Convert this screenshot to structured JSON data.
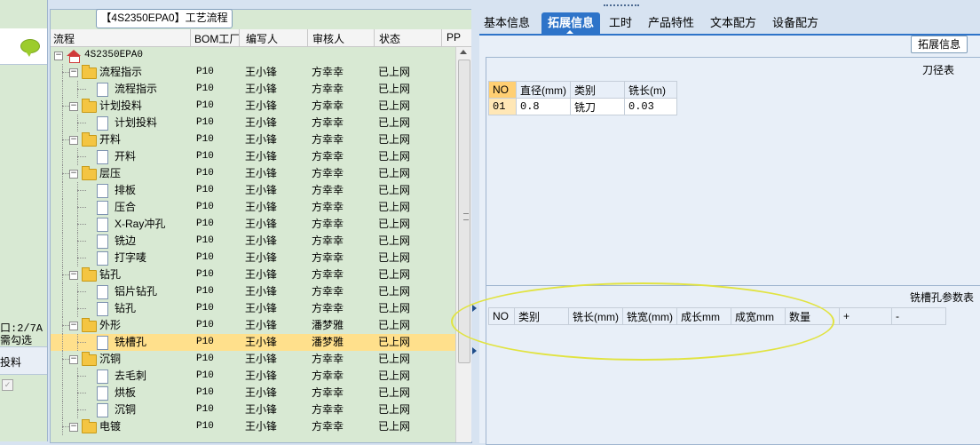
{
  "left_strip": {
    "line1": "口:2/7A",
    "line2": "需勾选",
    "header_label": "投料"
  },
  "tree": {
    "title": "【4S2350EPA0】工艺流程",
    "columns": [
      "流程",
      "BOM工厂",
      "编写人",
      "审核人",
      "状态",
      "PP"
    ],
    "rows": [
      {
        "label": "4S2350EPA0",
        "level": 0,
        "kind": "root",
        "factory": "",
        "writer": "",
        "reviewer": "",
        "status": ""
      },
      {
        "label": "流程指示",
        "level": 1,
        "kind": "folder",
        "factory": "P10",
        "writer": "王小锋",
        "reviewer": "方幸幸",
        "status": "已上网"
      },
      {
        "label": "流程指示",
        "level": 2,
        "kind": "doc",
        "factory": "P10",
        "writer": "王小锋",
        "reviewer": "方幸幸",
        "status": "已上网"
      },
      {
        "label": "计划投料",
        "level": 1,
        "kind": "folder",
        "factory": "P10",
        "writer": "王小锋",
        "reviewer": "方幸幸",
        "status": "已上网"
      },
      {
        "label": "计划投料",
        "level": 2,
        "kind": "doc",
        "factory": "P10",
        "writer": "王小锋",
        "reviewer": "方幸幸",
        "status": "已上网"
      },
      {
        "label": "开料",
        "level": 1,
        "kind": "folder",
        "factory": "P10",
        "writer": "王小锋",
        "reviewer": "方幸幸",
        "status": "已上网"
      },
      {
        "label": "开料",
        "level": 2,
        "kind": "doc",
        "factory": "P10",
        "writer": "王小锋",
        "reviewer": "方幸幸",
        "status": "已上网"
      },
      {
        "label": "层压",
        "level": 1,
        "kind": "folder",
        "factory": "P10",
        "writer": "王小锋",
        "reviewer": "方幸幸",
        "status": "已上网"
      },
      {
        "label": "排板",
        "level": 2,
        "kind": "doc",
        "factory": "P10",
        "writer": "王小锋",
        "reviewer": "方幸幸",
        "status": "已上网"
      },
      {
        "label": "压合",
        "level": 2,
        "kind": "doc",
        "factory": "P10",
        "writer": "王小锋",
        "reviewer": "方幸幸",
        "status": "已上网"
      },
      {
        "label": "X-Ray冲孔",
        "level": 2,
        "kind": "doc",
        "factory": "P10",
        "writer": "王小锋",
        "reviewer": "方幸幸",
        "status": "已上网"
      },
      {
        "label": "铣边",
        "level": 2,
        "kind": "doc",
        "factory": "P10",
        "writer": "王小锋",
        "reviewer": "方幸幸",
        "status": "已上网"
      },
      {
        "label": "打字唛",
        "level": 2,
        "kind": "doc",
        "factory": "P10",
        "writer": "王小锋",
        "reviewer": "方幸幸",
        "status": "已上网"
      },
      {
        "label": "钻孔",
        "level": 1,
        "kind": "folder",
        "factory": "P10",
        "writer": "王小锋",
        "reviewer": "方幸幸",
        "status": "已上网"
      },
      {
        "label": "铝片钻孔",
        "level": 2,
        "kind": "doc",
        "factory": "P10",
        "writer": "王小锋",
        "reviewer": "方幸幸",
        "status": "已上网"
      },
      {
        "label": "钻孔",
        "level": 2,
        "kind": "doc",
        "factory": "P10",
        "writer": "王小锋",
        "reviewer": "方幸幸",
        "status": "已上网"
      },
      {
        "label": "外形",
        "level": 1,
        "kind": "folder",
        "factory": "P10",
        "writer": "王小锋",
        "reviewer": "潘梦雅",
        "status": "已上网"
      },
      {
        "label": "铣槽孔",
        "level": 2,
        "kind": "doc",
        "factory": "P10",
        "writer": "王小锋",
        "reviewer": "潘梦雅",
        "status": "已上网",
        "selected": true
      },
      {
        "label": "沉铜",
        "level": 1,
        "kind": "folder",
        "factory": "P10",
        "writer": "王小锋",
        "reviewer": "方幸幸",
        "status": "已上网"
      },
      {
        "label": "去毛刺",
        "level": 2,
        "kind": "doc",
        "factory": "P10",
        "writer": "王小锋",
        "reviewer": "方幸幸",
        "status": "已上网"
      },
      {
        "label": "烘板",
        "level": 2,
        "kind": "doc",
        "factory": "P10",
        "writer": "王小锋",
        "reviewer": "方幸幸",
        "status": "已上网"
      },
      {
        "label": "沉铜",
        "level": 2,
        "kind": "doc",
        "factory": "P10",
        "writer": "王小锋",
        "reviewer": "方幸幸",
        "status": "已上网"
      },
      {
        "label": "电镀",
        "level": 1,
        "kind": "folder",
        "factory": "P10",
        "writer": "王小锋",
        "reviewer": "方幸幸",
        "status": "已上网"
      }
    ]
  },
  "tabs": [
    {
      "label": "基本信息",
      "active": false
    },
    {
      "label": "拓展信息",
      "active": true
    },
    {
      "label": "工时",
      "active": false
    },
    {
      "label": "产品特性",
      "active": false
    },
    {
      "label": "文本配方",
      "active": false
    },
    {
      "label": "设备配方",
      "active": false
    }
  ],
  "extended": {
    "button_label": "拓展信息",
    "knife_table": {
      "title": "刀径表",
      "headers": [
        "NO",
        "直径(mm)",
        "类别",
        "铣长(m)"
      ],
      "rows": [
        [
          "01",
          "0.8",
          "铣刀",
          "0.03"
        ]
      ]
    },
    "mill_table": {
      "title": "铣槽孔参数表",
      "headers": [
        "NO",
        "类别",
        "铣长(mm)",
        "铣宽(mm)",
        "成长mm",
        "成宽mm",
        "数量",
        "+",
        "-"
      ]
    }
  },
  "colors": {
    "tab_active": "#2e74c9",
    "selected_row": "#ffe08c",
    "tree_bg": "#d8e9d3",
    "highlight_ellipse": "#e1e340"
  }
}
